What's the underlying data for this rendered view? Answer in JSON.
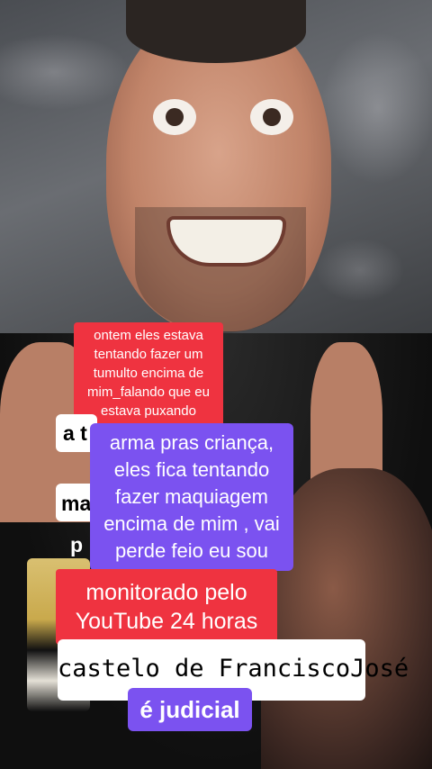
{
  "captions": {
    "red_top": [
      "ontem eles estava",
      "tentando fazer um",
      "tumulto encima de",
      "mim_falando que eu",
      "estava puxando"
    ],
    "partial_a": "a t",
    "partial_ma": "ma",
    "partial_p": "p",
    "purple_main": [
      "arma pras criança,",
      "eles fica tentando",
      "fazer maquiagem",
      "encima de mim , vai",
      "perde feio eu sou"
    ],
    "red_bottom": [
      "monitorado pelo",
      "YouTube 24 horas"
    ],
    "white_bottom": "castelo de FranciscoJosé",
    "purple_bottom": "é  judicial"
  }
}
